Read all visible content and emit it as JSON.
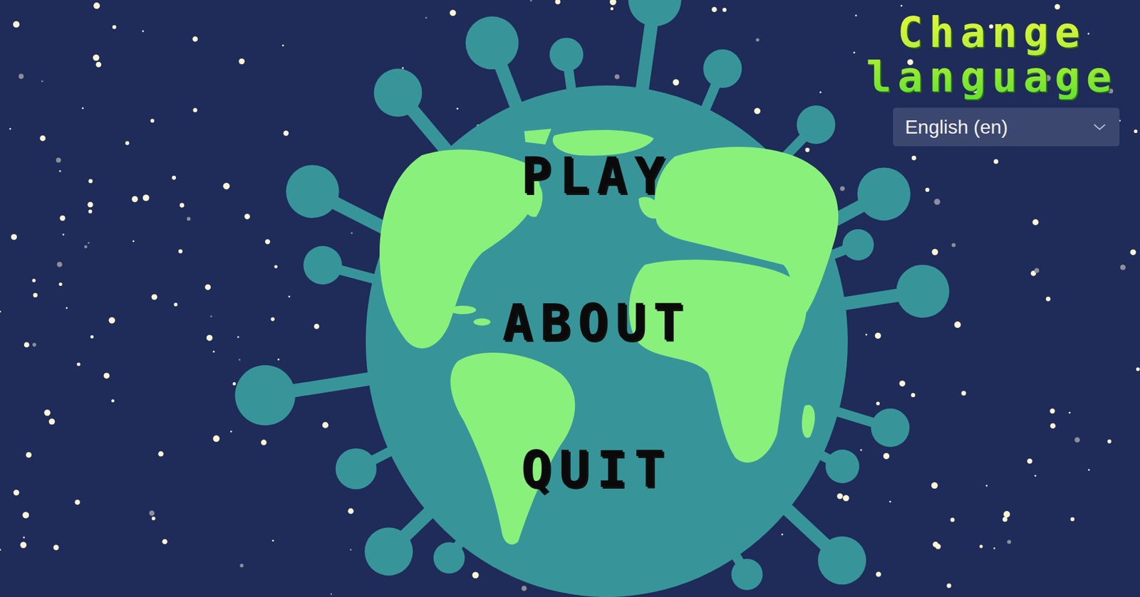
{
  "title": "Change language",
  "language_dropdown": {
    "value": "English (en)"
  },
  "menu": [
    {
      "label": "PLAY"
    },
    {
      "label": "ABOUT"
    },
    {
      "label": "QUIT"
    }
  ]
}
